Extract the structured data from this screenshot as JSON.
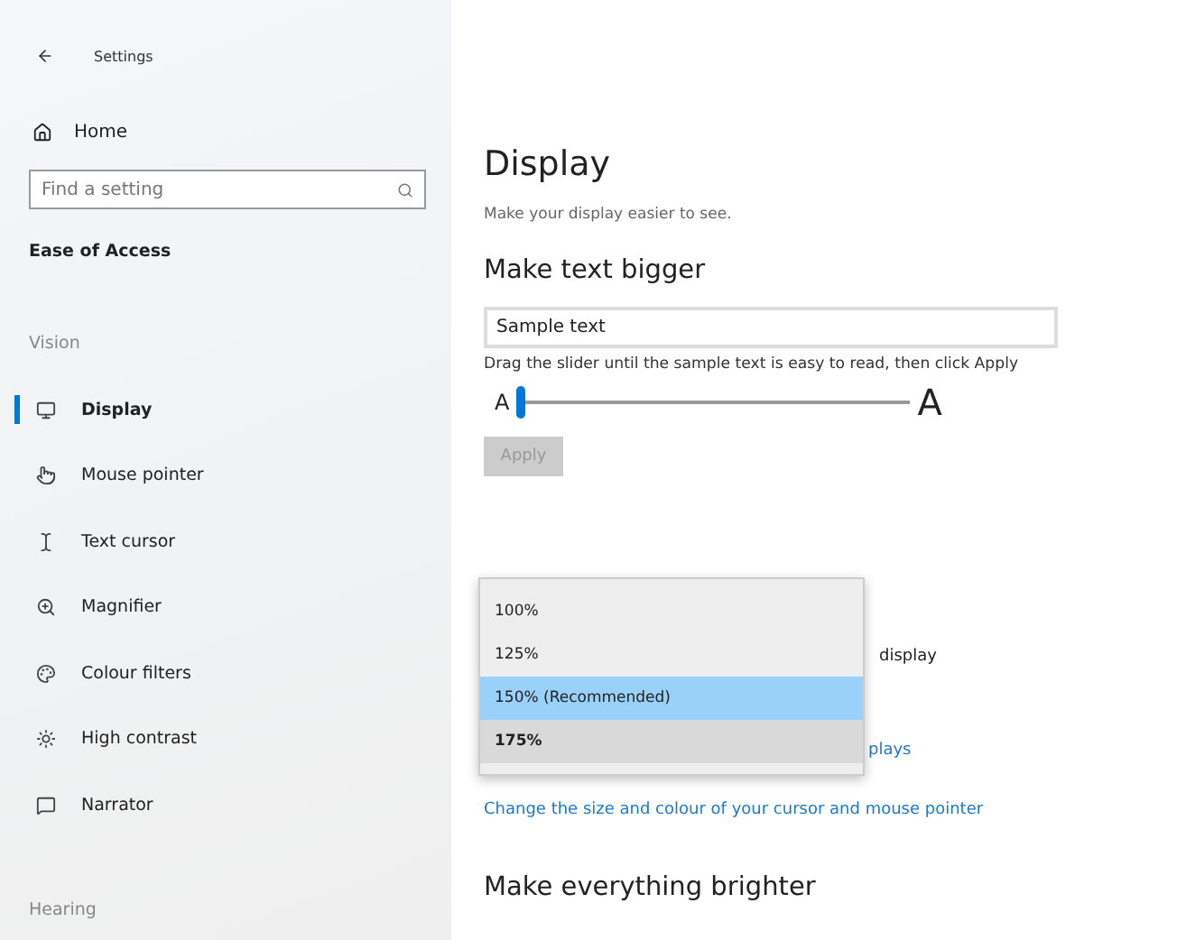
{
  "window": {
    "title": "Settings"
  },
  "sidebar": {
    "home": "Home",
    "search": {
      "placeholder": "Find a setting"
    },
    "category": "Ease of Access",
    "groups": [
      {
        "heading": "Vision",
        "items": [
          {
            "label": "Display",
            "selected": true
          },
          {
            "label": "Mouse pointer",
            "selected": false
          },
          {
            "label": "Text cursor",
            "selected": false
          },
          {
            "label": "Magnifier",
            "selected": false
          },
          {
            "label": "Colour filters",
            "selected": false
          },
          {
            "label": "High contrast",
            "selected": false
          },
          {
            "label": "Narrator",
            "selected": false
          }
        ]
      },
      {
        "heading": "Hearing"
      }
    ]
  },
  "page": {
    "title": "Display",
    "subtitle": "Make your display easier to see.",
    "text_size": {
      "heading": "Make text bigger",
      "sample": "Sample text",
      "hint": "Drag the slider until the sample text is easy to read, then click Apply",
      "small_label": "A",
      "large_label": "A",
      "level": 0.0,
      "apply": {
        "label": "Apply",
        "disabled": true
      }
    },
    "hidden_rows": [
      "display",
      "plays"
    ],
    "link": "Change the size and colour of your cursor and mouse pointer",
    "next_heading": "Make everything brighter",
    "dropdown": {
      "options": [
        {
          "label": "100%",
          "selected": false,
          "hovered": false
        },
        {
          "label": "125%",
          "selected": false,
          "hovered": false
        },
        {
          "label": "150% (Recommended)",
          "selected": true,
          "hovered": false
        },
        {
          "label": "175%",
          "selected": false,
          "hovered": true
        }
      ]
    }
  }
}
